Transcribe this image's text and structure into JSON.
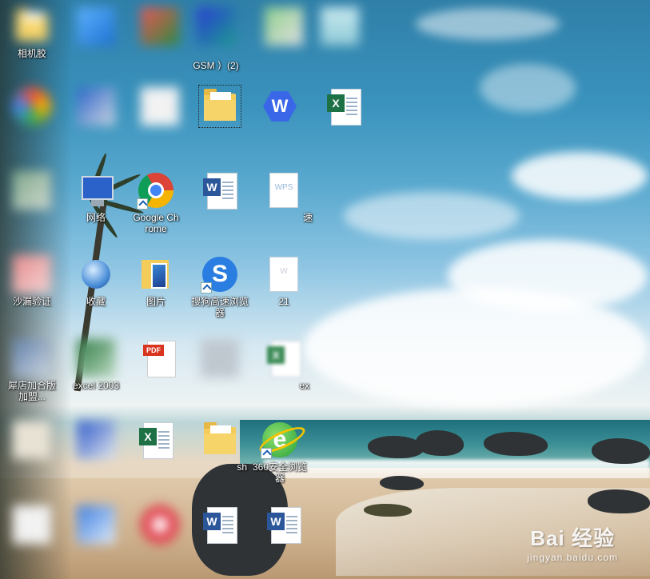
{
  "desktop": {
    "icons": [
      {
        "label": "相机胶",
        "blur": true,
        "glyph": "folder-icon"
      },
      {
        "label": "",
        "blur": true,
        "glyph": "app-icon"
      },
      {
        "label": "",
        "blur": true,
        "glyph": "app-icon"
      },
      {
        "label": "GSM ）(2)",
        "blur": false,
        "glyph": "app-icon"
      },
      {
        "label": "",
        "blur": true,
        "glyph": "app-icon"
      },
      {
        "label": "",
        "blur": true,
        "glyph": "app-icon"
      },
      {
        "label": "",
        "blur": true,
        "glyph": "app-icon"
      },
      {
        "label": "",
        "blur": true,
        "glyph": "app-icon"
      },
      {
        "label": "",
        "blur": true,
        "glyph": "document-icon"
      },
      {
        "label": "",
        "blur": false,
        "glyph": "folder-icon"
      },
      {
        "label": "",
        "blur": false,
        "glyph": "wps-office-icon"
      },
      {
        "label": "",
        "blur": false,
        "glyph": "excel-icon"
      },
      {
        "label": "",
        "blur": true,
        "glyph": "app-icon"
      },
      {
        "label": "网络",
        "blur": false,
        "glyph": "network-icon"
      },
      {
        "label": "Google Chrome",
        "blur": false,
        "glyph": "chrome-icon"
      },
      {
        "label": "",
        "blur": false,
        "glyph": "word-icon"
      },
      {
        "label": "速",
        "blur": false,
        "glyph": "wps-doc-icon"
      },
      {
        "label": "沙漏验证",
        "blur": true,
        "glyph": "app-icon"
      },
      {
        "label": "收藏",
        "blur": true,
        "glyph": "favorites-icon"
      },
      {
        "label": "图片",
        "blur": false,
        "glyph": "photos-folder-icon"
      },
      {
        "label": "搜狗高速浏览器",
        "blur": false,
        "glyph": "sogou-browser-icon"
      },
      {
        "label": "21",
        "blur": false,
        "glyph": "document-icon"
      },
      {
        "label": "犀店加合版加盟...",
        "blur": true,
        "glyph": "app-icon"
      },
      {
        "label": "excel 2003",
        "blur": true,
        "glyph": "excel-icon"
      },
      {
        "label": "",
        "blur": true,
        "glyph": "pdf-icon"
      },
      {
        "label": "",
        "blur": true,
        "glyph": "app-icon"
      },
      {
        "label": "ex",
        "blur": true,
        "glyph": "document-icon"
      },
      {
        "label": "",
        "blur": true,
        "glyph": "app-icon"
      },
      {
        "label": "",
        "blur": true,
        "glyph": "app-icon"
      },
      {
        "label": "",
        "blur": false,
        "glyph": "excel-icon"
      },
      {
        "label": "sh",
        "blur": false,
        "glyph": "folder-icon"
      },
      {
        "label": "360安全浏览器",
        "blur": false,
        "glyph": "360-browser-icon"
      },
      {
        "label": "",
        "blur": true,
        "glyph": "document-icon"
      },
      {
        "label": "",
        "blur": true,
        "glyph": "app-icon"
      },
      {
        "label": "",
        "blur": true,
        "glyph": "music-icon"
      },
      {
        "label": "",
        "blur": false,
        "glyph": "word-icon"
      },
      {
        "label": "",
        "blur": false,
        "glyph": "word-icon"
      }
    ]
  },
  "watermark": {
    "main": "Bai 经验",
    "sub": "jingyan.baidu.com"
  }
}
